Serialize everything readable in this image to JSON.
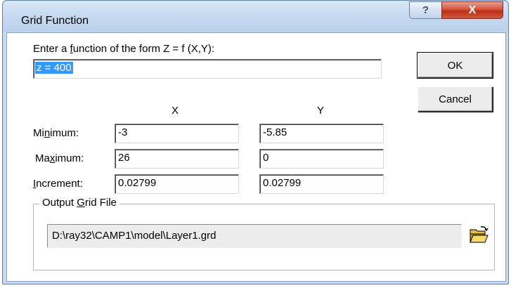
{
  "window": {
    "title": "Grid Function",
    "help_glyph": "?",
    "close_glyph": "X"
  },
  "function": {
    "label_before": "Enter a ",
    "label_mnemonic": "f",
    "label_after": "unction of the form Z = f (X,Y):",
    "value": "z = 400"
  },
  "columns": {
    "x": "X",
    "y": "Y"
  },
  "rows": {
    "minimum": {
      "label_before": "Mi",
      "label_mnemonic": "n",
      "label_after": "imum:",
      "x": "-3",
      "y": "-5.85"
    },
    "maximum": {
      "label_before": "Ma",
      "label_mnemonic": "x",
      "label_after": "imum:",
      "x": "26",
      "y": "0"
    },
    "increment": {
      "label_before": "",
      "label_mnemonic": "I",
      "label_after": "ncrement:",
      "x": "0.02799",
      "y": "0.02799"
    }
  },
  "buttons": {
    "ok": "OK",
    "cancel": "Cancel"
  },
  "output": {
    "group_before": "Output ",
    "group_mnemonic": "G",
    "group_after": "rid File",
    "path": "D:\\ray32\\CAMP1\\model\\Layer1.grd",
    "browse_icon": "open-folder-icon"
  }
}
